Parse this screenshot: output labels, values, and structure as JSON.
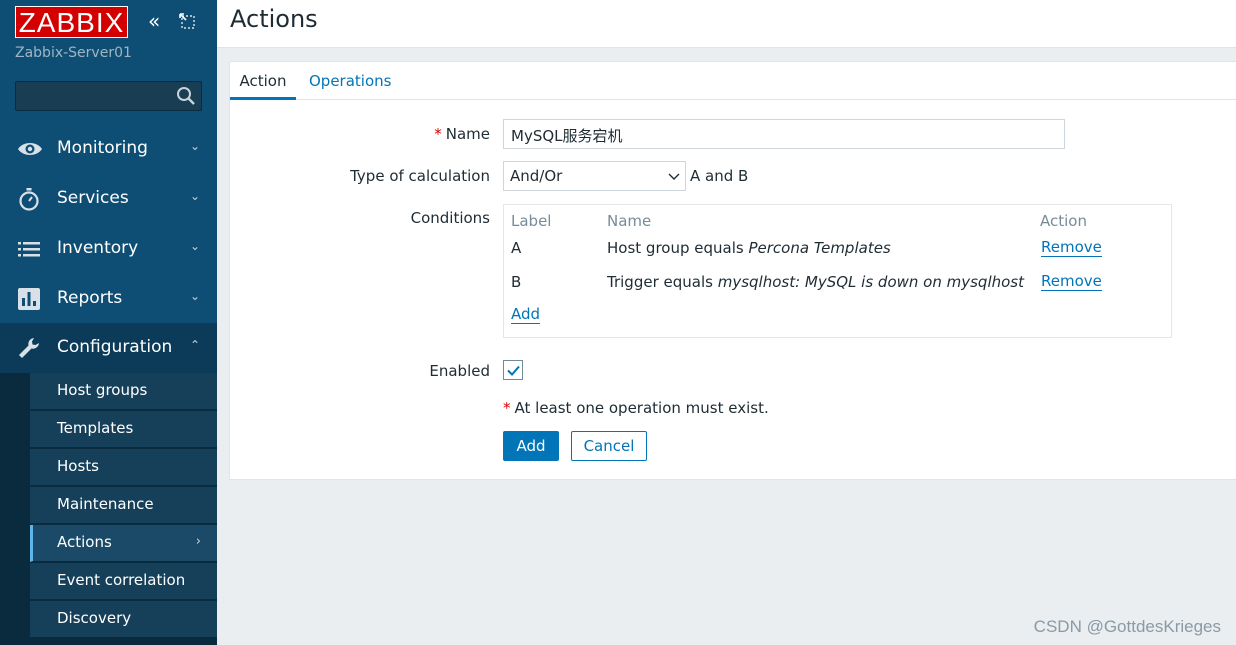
{
  "sidebar": {
    "logo": "ZABBIX",
    "collapse_glyph": "«",
    "server_name": "Zabbix-Server01",
    "search_placeholder": "",
    "menu": [
      {
        "label": "Monitoring",
        "icon": "eye-icon",
        "chevron": "⌄"
      },
      {
        "label": "Services",
        "icon": "stopwatch-icon",
        "chevron": "⌄"
      },
      {
        "label": "Inventory",
        "icon": "list-icon",
        "chevron": "⌄"
      },
      {
        "label": "Reports",
        "icon": "bar-chart-icon",
        "chevron": "⌄"
      },
      {
        "label": "Configuration",
        "icon": "wrench-icon",
        "chevron": "⌃"
      }
    ],
    "submenu": [
      {
        "label": "Host groups"
      },
      {
        "label": "Templates"
      },
      {
        "label": "Hosts"
      },
      {
        "label": "Maintenance"
      },
      {
        "label": "Actions",
        "chevron": "›"
      },
      {
        "label": "Event correlation"
      },
      {
        "label": "Discovery"
      }
    ]
  },
  "page": {
    "title": "Actions"
  },
  "tabs": [
    {
      "label": "Action"
    },
    {
      "label": "Operations"
    }
  ],
  "form": {
    "required_mark": "*",
    "name_label": "Name",
    "name_value": "MySQL服务宕机",
    "calc_label": "Type of calculation",
    "calc_value": "And/Or",
    "calc_expression": "A and B",
    "conditions_label": "Conditions",
    "conditions_headers": {
      "label": "Label",
      "name": "Name",
      "action": "Action"
    },
    "conditions": [
      {
        "label": "A",
        "prefix": "Host group equals ",
        "value": "Percona Templates",
        "action": "Remove"
      },
      {
        "label": "B",
        "prefix": "Trigger equals ",
        "value": "mysqlhost: MySQL is down on mysqlhost",
        "action": "Remove"
      }
    ],
    "add_condition": "Add",
    "enabled_label": "Enabled",
    "enabled": true,
    "warning": "At least one operation must exist.",
    "add_button": "Add",
    "cancel_button": "Cancel"
  },
  "watermark": "CSDN @GottdesKrieges",
  "colors": {
    "sidebar_bg": "#0f4e74",
    "accent": "#0275b8",
    "logo_red": "#d40000",
    "required": "#d40000"
  }
}
